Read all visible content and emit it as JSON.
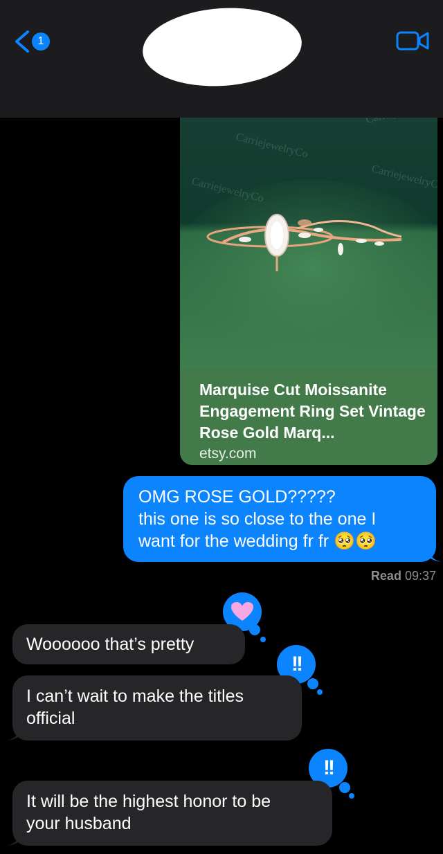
{
  "header": {
    "unread_count": "1",
    "back_icon": "chevron-left-icon",
    "video_icon": "video-camera-icon",
    "accent": "#0a84ff"
  },
  "link_preview": {
    "watermark": "CarriejewelryCo",
    "title": "Marquise Cut Moissanite Engagement Ring Set Vintage Rose Gold Marq...",
    "domain": "etsy.com",
    "card_color": "#437a4a"
  },
  "outgoing": {
    "text": "OMG ROSE GOLD?????\nthis one is so close to the one I\nwant for the wedding fr fr 🥺🥺",
    "bubble_color": "#0b84fe"
  },
  "receipt": {
    "label": "Read",
    "time": "09:37"
  },
  "incoming": [
    {
      "text": "Woooooo that’s pretty",
      "reaction": "heart"
    },
    {
      "text": "I can’t wait to make the titles\nofficial",
      "reaction": "!!"
    },
    {
      "text": "It will be the highest honor to be\nyour husband",
      "reaction": "!!"
    }
  ]
}
